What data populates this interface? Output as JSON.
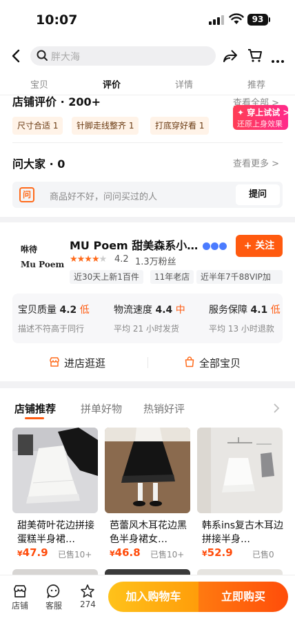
{
  "status_bar": {
    "time": "10:07",
    "battery": "93"
  },
  "search": {
    "placeholder": "胖大海"
  },
  "tabs": [
    "宝贝",
    "评价",
    "详情",
    "推荐"
  ],
  "active_tab": "评价",
  "reviews": {
    "title": "店铺评价 · 200+",
    "see_all": "查看全部 >",
    "tryon_line1": "✦ 穿上试试 >",
    "tryon_line2": "还原上身效果",
    "tags": [
      "尺寸合适 1",
      "针脚走线整齐 1",
      "打底穿好看 1"
    ]
  },
  "ask": {
    "title": "问大家 · 0",
    "see_more": "查看更多 >",
    "icon_text": "问",
    "placeholder": "商品好不好，问问买过的人",
    "button": "提问"
  },
  "store": {
    "logo_top": "咻待",
    "logo_main": "Mu Poem",
    "name": "MU Poem 甜美森系小…",
    "follow": "+ 关注",
    "stars_on": "★★★★",
    "stars_off": "★",
    "rating": "4.2",
    "fans": "1.3万粉丝",
    "tags": [
      "近30天上新1百件",
      "11年老店",
      "近半年7千88VIP加"
    ],
    "metrics": [
      {
        "label": "宝贝质量",
        "value": "4.2",
        "level": "低",
        "desc": "描述不符高于同行"
      },
      {
        "label": "物流速度",
        "value": "4.4",
        "level": "中",
        "desc": "平均 21 小时发货"
      },
      {
        "label": "服务保障",
        "value": "4.1",
        "level": "低",
        "desc": "平均 13 小时退款"
      }
    ],
    "visit_store": "进店逛逛",
    "all_items": "全部宝贝"
  },
  "recommend": {
    "tabs": [
      "店铺推荐",
      "拼单好物",
      "热销好评"
    ],
    "products": [
      {
        "title": "甜美荷叶花边拼接蛋糕半身裙…",
        "price": "47.9",
        "sold": "已售10+"
      },
      {
        "title": "芭蕾风木耳花边黑色半身裙女…",
        "price": "46.8",
        "sold": "已售10+"
      },
      {
        "title": "韩系ins复古木耳边拼接半身…",
        "price": "52.9",
        "sold": "已售0"
      }
    ],
    "currency": "¥"
  },
  "bottom_bar": {
    "shop": "店铺",
    "service": "客服",
    "favorites": "274",
    "add_to_cart": "加入购物车",
    "buy_now": "立即购买"
  },
  "colors": {
    "accent": "#ff5a0f",
    "price": "#ff4b0a",
    "cart_button": "#ffb312",
    "buy_button": "#ff5a0f"
  }
}
